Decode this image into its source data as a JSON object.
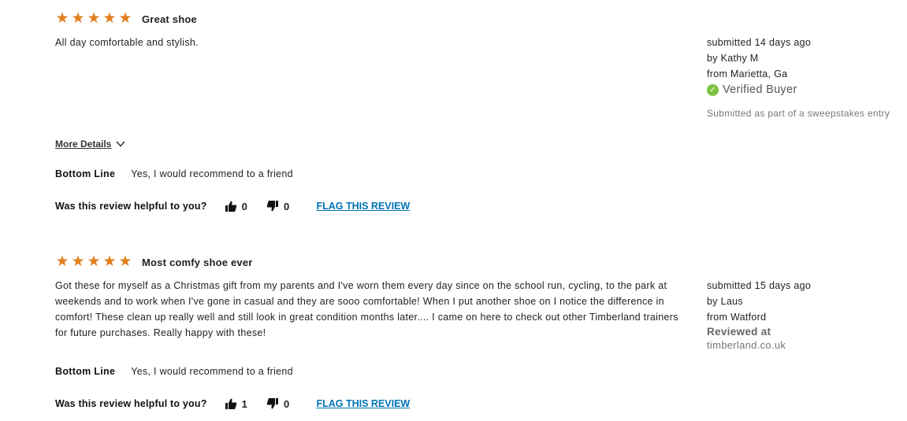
{
  "reviews": [
    {
      "rating": 5,
      "stars": "★★★★★",
      "headline": "Great shoe",
      "body": "All day comfortable and stylish.",
      "submitted": "submitted 14 days ago",
      "by": "by Kathy M",
      "from": "from Marietta, Ga",
      "verified_label": "Verified Buyer",
      "sweepstakes": "Submitted as part of a sweepstakes entry",
      "more_details": "More Details",
      "bottom_line_label": "Bottom Line",
      "bottom_line_value": "Yes, I would recommend to a friend",
      "helpful_label": "Was this review helpful to you?",
      "helpful_yes": "0",
      "helpful_no": "0",
      "flag_label": "FLAG THIS REVIEW"
    },
    {
      "rating": 5,
      "stars": "★★★★★",
      "headline": "Most comfy shoe ever",
      "body": "Got these for myself as a Christmas gift from my parents and I've worn them every day since on the school run, cycling, to the park at weekends and to work when I've gone in casual and they are sooo comfortable! When I put another shoe on I notice the difference in comfort! These clean up really well and still look in great condition months later.... I came on here to check out other Timberland trainers for future purchases. Really happy with these!",
      "submitted": "submitted 15 days ago",
      "by": "by Laus",
      "from": "from Watford",
      "reviewed_at_label": "Reviewed at",
      "reviewed_at_site": "timberland.co.uk",
      "bottom_line_label": "Bottom Line",
      "bottom_line_value": "Yes, I would recommend to a friend",
      "helpful_label": "Was this review helpful to you?",
      "helpful_yes": "1",
      "helpful_no": "0",
      "flag_label": "FLAG THIS REVIEW"
    }
  ],
  "colors": {
    "star": "#e17e1d",
    "link": "#0073b7",
    "verified": "#7cc242"
  },
  "icons": {
    "rating": "star-icon",
    "verified": "check-circle-icon",
    "details": "chevron-down-icon",
    "helpful_yes": "thumbs-up-icon",
    "helpful_no": "thumbs-down-icon"
  }
}
